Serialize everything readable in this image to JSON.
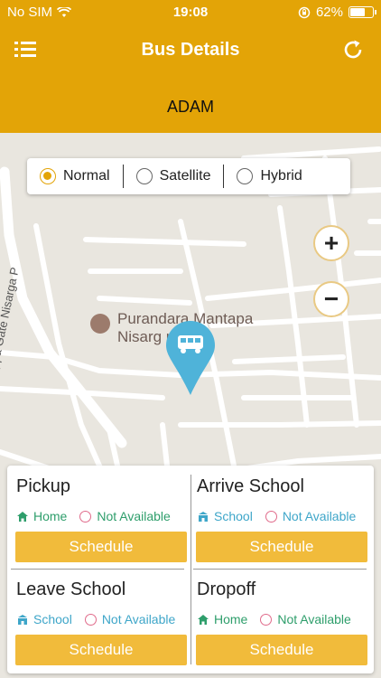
{
  "status": {
    "carrier": "No SIM",
    "time": "19:08",
    "battery": "62%",
    "battery_level": 0.62
  },
  "navbar": {
    "title": "Bus Details",
    "menu_icon": "list-icon",
    "refresh_icon": "refresh-icon"
  },
  "student": {
    "name": "ADAM"
  },
  "map_type": {
    "options": [
      "Normal",
      "Satellite",
      "Hybrid"
    ],
    "selected": "Normal"
  },
  "map": {
    "zoom_in": "+",
    "zoom_out": "−",
    "poi_line1": "Purandara Mantapa",
    "poi_line2": "Nisarg      ut...",
    "road_label_1": "Koppa Gate Nisarga P",
    "pin_icon": "bus-icon"
  },
  "schedule": [
    {
      "title": "Pickup",
      "location": "Home",
      "location_icon": "home-icon",
      "status": "Not Available",
      "button": "Schedule"
    },
    {
      "title": "Arrive School",
      "location": "School",
      "location_icon": "school-icon",
      "status": "Not Available",
      "button": "Schedule"
    },
    {
      "title": "Leave School",
      "location": "School",
      "location_icon": "school-icon",
      "status": "Not Available",
      "button": "Schedule"
    },
    {
      "title": "Dropoff",
      "location": "Home",
      "location_icon": "home-icon",
      "status": "Not Available",
      "button": "Schedule"
    }
  ],
  "colors": {
    "accent": "#e3a407",
    "button": "#f1bb3b",
    "home": "#2e9e6b",
    "school": "#3ea6c9",
    "clock": "#e06b8b"
  }
}
